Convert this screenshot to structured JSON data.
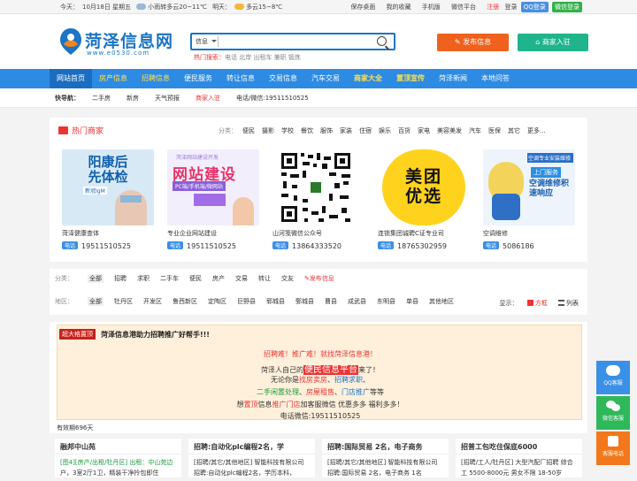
{
  "topbar": {
    "today_label": "今天：",
    "date": "10月18日 星期五",
    "weather_today": "小雨转多云20~11℃",
    "tomorrow_label": "明天：",
    "weather_tomorrow": "多云15~8℃",
    "links": [
      "保存桌面",
      "我的收藏",
      "手机版",
      "微信平台"
    ],
    "register": "注册",
    "login": "登录",
    "qq_login": "QQ登录",
    "wechat_login": "微信登录"
  },
  "header": {
    "logo_text": "菏泽信息网",
    "logo_url_text": "www.e0530.com",
    "search_category": "信息",
    "hot_label": "热门搜索：",
    "hot_terms": "电话 北岸 出租车 兼职 锻炼",
    "publish_button": "发布信息",
    "join_button": "商家入驻"
  },
  "nav": {
    "items": [
      "网站首页",
      "房产信息",
      "招聘信息",
      "便民服务",
      "转让信息",
      "交易信息",
      "汽车交易",
      "商家大全",
      "置顶宣传",
      "菏泽新闻",
      "本地问答"
    ]
  },
  "quick": {
    "label": "快导航：",
    "items": [
      "二手房",
      "新房",
      "天气预报",
      "商家入驻",
      "电话/微信:19511510525"
    ]
  },
  "hot_merchants": {
    "title": "热门商家",
    "category_label": "分类：",
    "categories": [
      "便民",
      "摄影",
      "学校",
      "餐饮",
      "服饰",
      "家装",
      "住宿",
      "娱乐",
      "百货",
      "家电",
      "美容美发",
      "汽车",
      "医保",
      "其它",
      "更多..."
    ],
    "cards": [
      {
        "name": "菏泽健康查体",
        "tel_tag": "电话",
        "tel": "19511510525",
        "img_text": "阳康后先体检",
        "img_sub": "新冠IgM"
      },
      {
        "name": "专业企业网站建设",
        "tel_tag": "电话",
        "tel": "19511510525",
        "img_text": "网站建设",
        "img_sub": "PC端/手机端/微网站",
        "img_top": "菏泽网站建设开发"
      },
      {
        "name": "山河笺微信公众号",
        "tel_tag": "电话",
        "tel": "13864333520",
        "img_text": "",
        "img_sub": ""
      },
      {
        "name": "连锁集团诚聘C证专业司",
        "tel_tag": "电话",
        "tel": "18765302959",
        "img_text": "美团优选",
        "img_sub": ""
      },
      {
        "name": "空调维修",
        "tel_tag": "电话",
        "tel": "5086186",
        "img_text": "空调维修积速响应",
        "img_sub": "空调专业安装维修",
        "img_top2": "上门服务"
      }
    ]
  },
  "filters": {
    "class_label": "分类：",
    "classes": [
      "全部",
      "招聘",
      "求职",
      "二手车",
      "便民",
      "房产",
      "交易",
      "转让",
      "交友"
    ],
    "publish_link": "发布信息",
    "area_label": "地区：",
    "areas": [
      "全部",
      "牡丹区",
      "开发区",
      "鲁西新区",
      "定陶区",
      "巨野县",
      "郓城县",
      "鄄城县",
      "曹县",
      "成武县",
      "东明县",
      "单县",
      "其他地区"
    ],
    "display_label": "显示：",
    "grid_view": "方框",
    "list_view": "列表"
  },
  "ad": {
    "tag": "超大格置顶",
    "title": "菏泽信息港助力招聘推广好帮手!!!",
    "line1": "招聘难！推广难！就找菏泽信息港！",
    "line2_a": "菏泽人自己的",
    "line2_hl": "便民信息平台",
    "line2_b": "来了！",
    "line3_a": "无论你是",
    "line3_b": "找房卖房",
    "line3_c": "、",
    "line3_d": "招聘求职",
    "line3_e": "、",
    "line4_a": "二手闲置处理",
    "line4_b": "、",
    "line4_c": "房屋租售",
    "line4_d": "、",
    "line4_e": "门店推广",
    "line4_f": "等等",
    "line5_a": "想",
    "line5_b": "置顶",
    "line5_c": "信息",
    "line5_d": "推广门店",
    "line5_e": "加客服微信 优惠多多 福利多多！",
    "line6": "电话微信:19511510525",
    "validity": "有效期696天"
  },
  "listings": [
    {
      "title": "融邦中山苑",
      "line": "[图4][房产/出租/牡丹区] 出租：中山苑边",
      "line2": "户，3室2厅1卫，精装干净拎包即住"
    },
    {
      "title": "招聘:自动化plc编程2名，学",
      "line": "[招聘/其它/其他地区] 智能科技有限公司",
      "line2": "招聘:自动化plc编程2名，学历本科，"
    },
    {
      "title": "招聘:国际贸易 2名，电子商务",
      "line": "[招聘/其它/其他地区] 智能科技有限公司",
      "line2": "招聘:国际贸易 2名，电子商务 1名"
    },
    {
      "title": "招普工包吃住保底6000",
      "line": "[招聘/工人/牡丹区] 大型汽配厂招聘 综合",
      "line2": "工 5500-8000元 男女不限 18-50岁"
    }
  ],
  "side": {
    "qq": "QQ客服",
    "wechat": "微信客服",
    "phone": "客服电话"
  },
  "colors": {
    "brand_blue": "#2d8be3",
    "accent_red": "#e33",
    "orange": "#f0611e",
    "teal": "#1fb48c"
  }
}
